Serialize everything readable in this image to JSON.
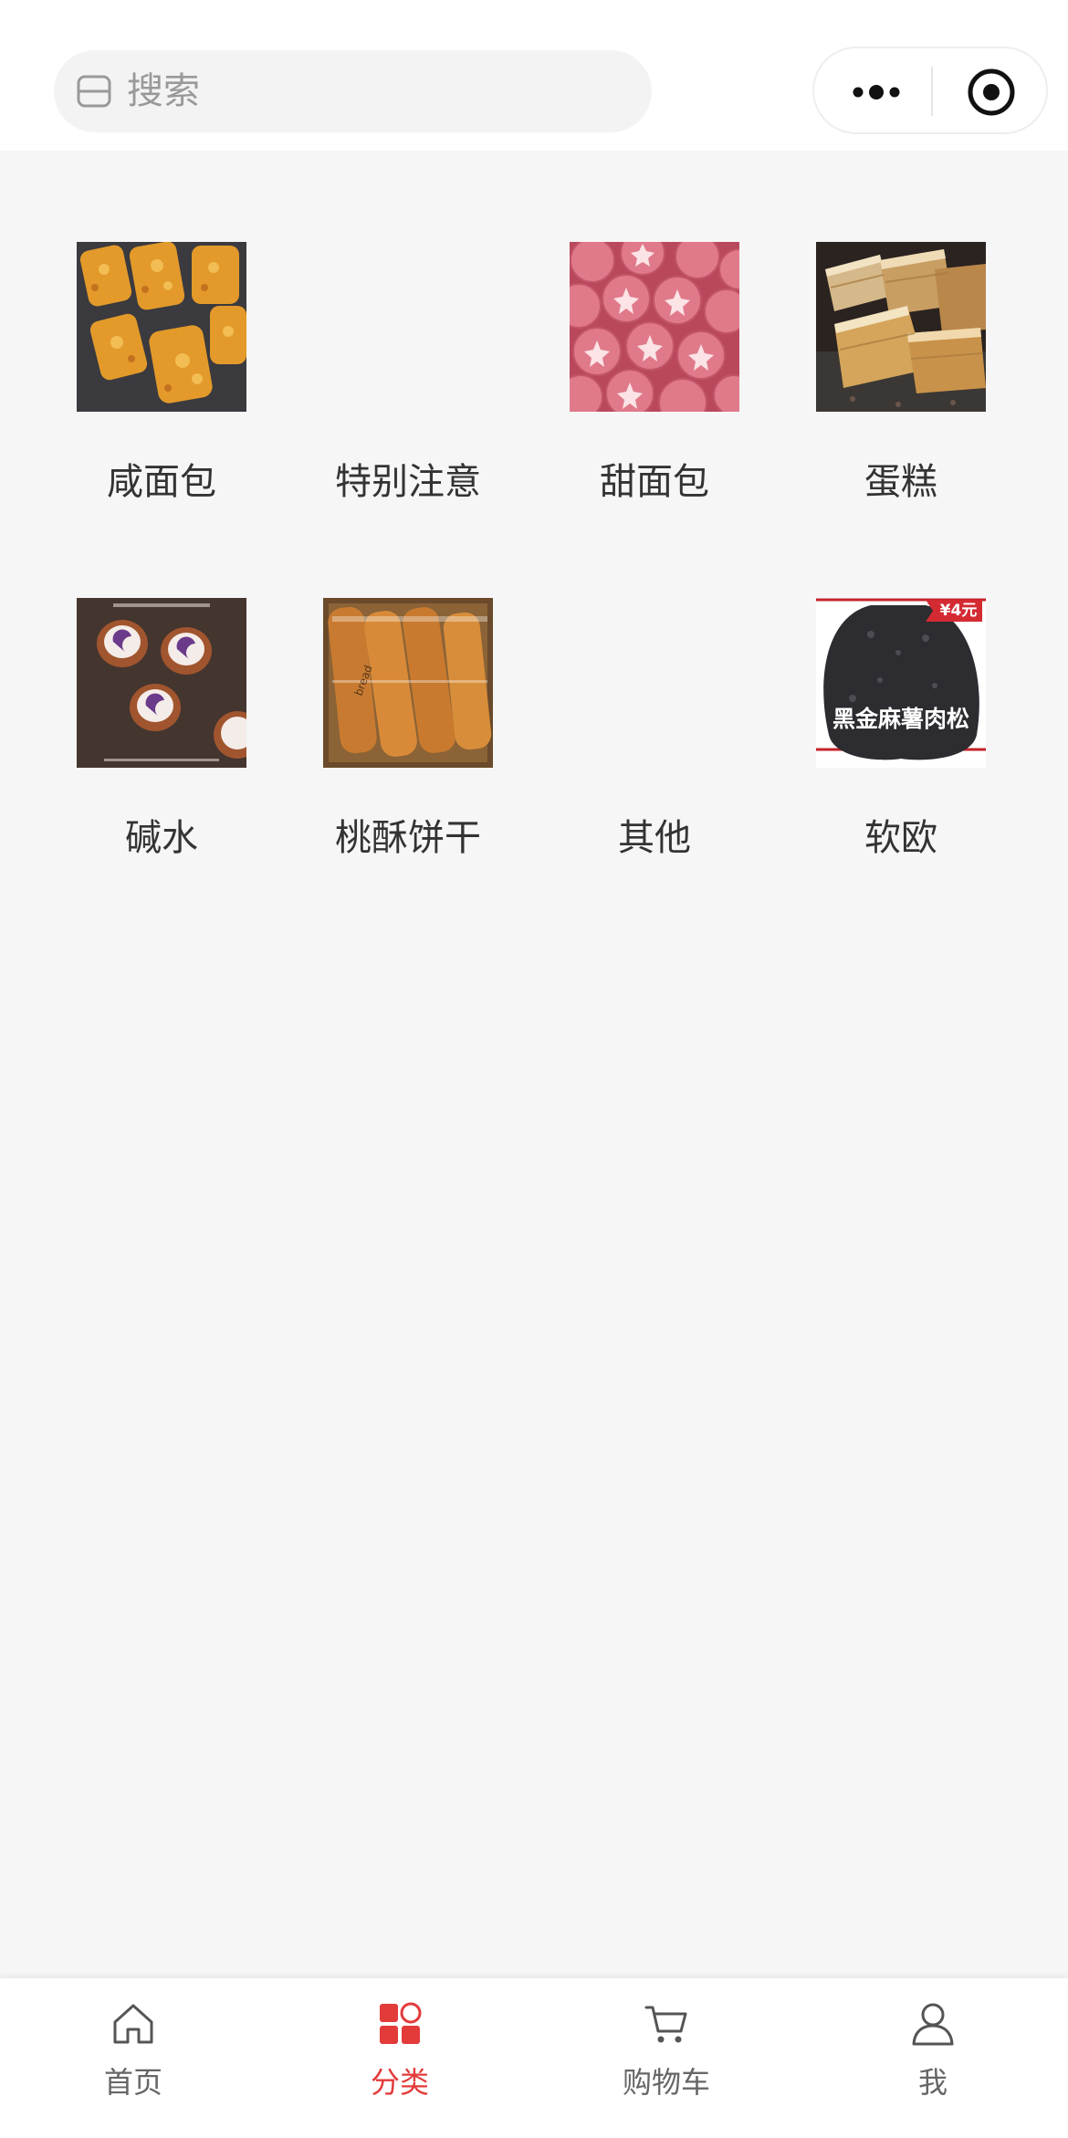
{
  "search": {
    "placeholder": "搜索"
  },
  "capsule": {
    "more_icon": "more-dots-icon",
    "close_icon": "target-icon"
  },
  "categories": [
    {
      "label": "咸面包",
      "has_image": true,
      "image": "savory-bread-photo"
    },
    {
      "label": "特别注意",
      "has_image": false
    },
    {
      "label": "甜面包",
      "has_image": true,
      "image": "sweet-bread-photo"
    },
    {
      "label": "蛋糕",
      "has_image": true,
      "image": "cake-photo"
    },
    {
      "label": "碱水",
      "has_image": true,
      "image": "pretzel-bread-photo"
    },
    {
      "label": "桃酥饼干",
      "has_image": true,
      "image": "cookies-photo"
    },
    {
      "label": "其他",
      "has_image": false
    },
    {
      "label": "软欧",
      "has_image": true,
      "image": "soft-euro-bread-photo",
      "image_price_tag": "¥4元",
      "image_caption": "黑金麻薯肉松"
    }
  ],
  "tabbar": {
    "items": [
      {
        "label": "首页",
        "icon": "home-icon",
        "active": false
      },
      {
        "label": "分类",
        "icon": "category-icon",
        "active": true
      },
      {
        "label": "购物车",
        "icon": "cart-icon",
        "active": false
      },
      {
        "label": "我",
        "icon": "user-icon",
        "active": false
      }
    ],
    "active_color": "#e33a3a",
    "inactive_color": "#666666"
  }
}
